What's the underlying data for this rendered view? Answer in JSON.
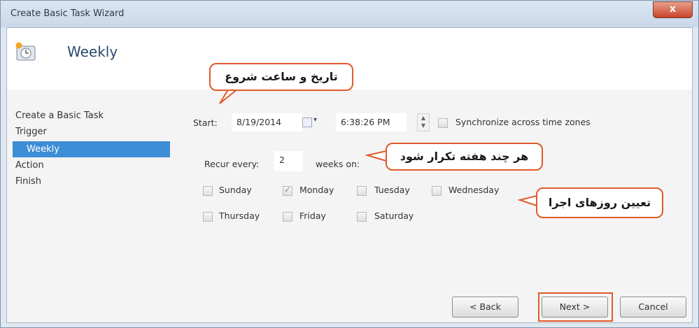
{
  "window": {
    "title": "Create Basic Task Wizard",
    "close_glyph": "x"
  },
  "header": {
    "heading": "Weekly",
    "icon": "clock-task-icon"
  },
  "nav": {
    "items": [
      {
        "label": "Create a Basic Task"
      },
      {
        "label": "Trigger"
      },
      {
        "label": "Weekly"
      },
      {
        "label": "Action"
      },
      {
        "label": "Finish"
      }
    ]
  },
  "start": {
    "label": "Start:",
    "date": "8/19/2014",
    "time": "6:38:26 PM",
    "sync_label": "Synchronize across time zones"
  },
  "recur": {
    "label": "Recur every:",
    "value": "2",
    "suffix": "weeks on:"
  },
  "days": [
    {
      "label": "Sunday",
      "checked": false
    },
    {
      "label": "Monday",
      "checked": true
    },
    {
      "label": "Tuesday",
      "checked": false
    },
    {
      "label": "Wednesday",
      "checked": false
    },
    {
      "label": "Thursday",
      "checked": false
    },
    {
      "label": "Friday",
      "checked": false
    },
    {
      "label": "Saturday",
      "checked": false
    }
  ],
  "callouts": {
    "start": "تاریخ و ساعت شروع",
    "recur": "هر چند هفته تکرار شود",
    "days": "تعیین روزهای اجرا"
  },
  "buttons": {
    "back": "< Back",
    "next": "Next >",
    "cancel": "Cancel"
  },
  "colors": {
    "accent": "#3d8ed6",
    "callout_border": "#e05a2a",
    "close": "#c8442a"
  }
}
